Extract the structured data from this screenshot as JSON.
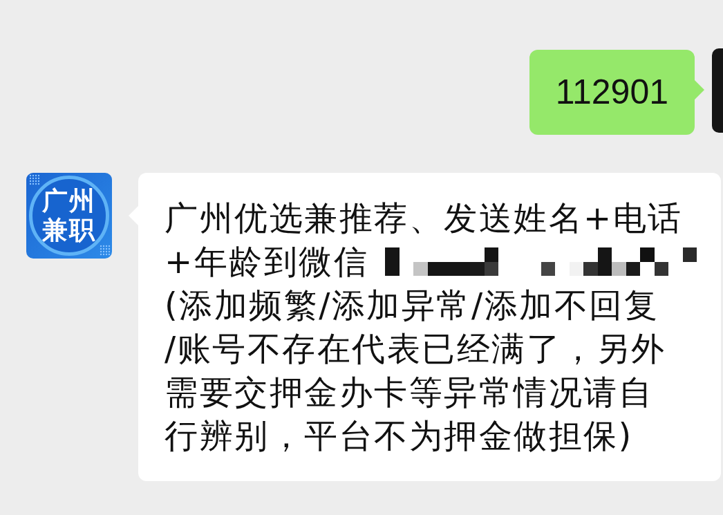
{
  "chat": {
    "messages": [
      {
        "kind": "outgoing",
        "text": "112901"
      },
      {
        "kind": "incoming",
        "avatar": {
          "label": "广州兼职"
        },
        "lines": [
          {
            "text": "广州优选兼推荐、发送姓名+电话",
            "redaction_after": false
          },
          {
            "text": "+年龄到微信",
            "redaction_after": true
          },
          {
            "text": "(添加频繁/添加异常/添加不回复",
            "redaction_after": false
          },
          {
            "text": "/账号不存在代表已经满了，另外",
            "redaction_after": false
          },
          {
            "text": "需要交押金办卡等异常情况请自",
            "redaction_after": false
          },
          {
            "text": "行辨别，平台不为押金做担保)",
            "redaction_after": false
          }
        ]
      }
    ]
  }
}
